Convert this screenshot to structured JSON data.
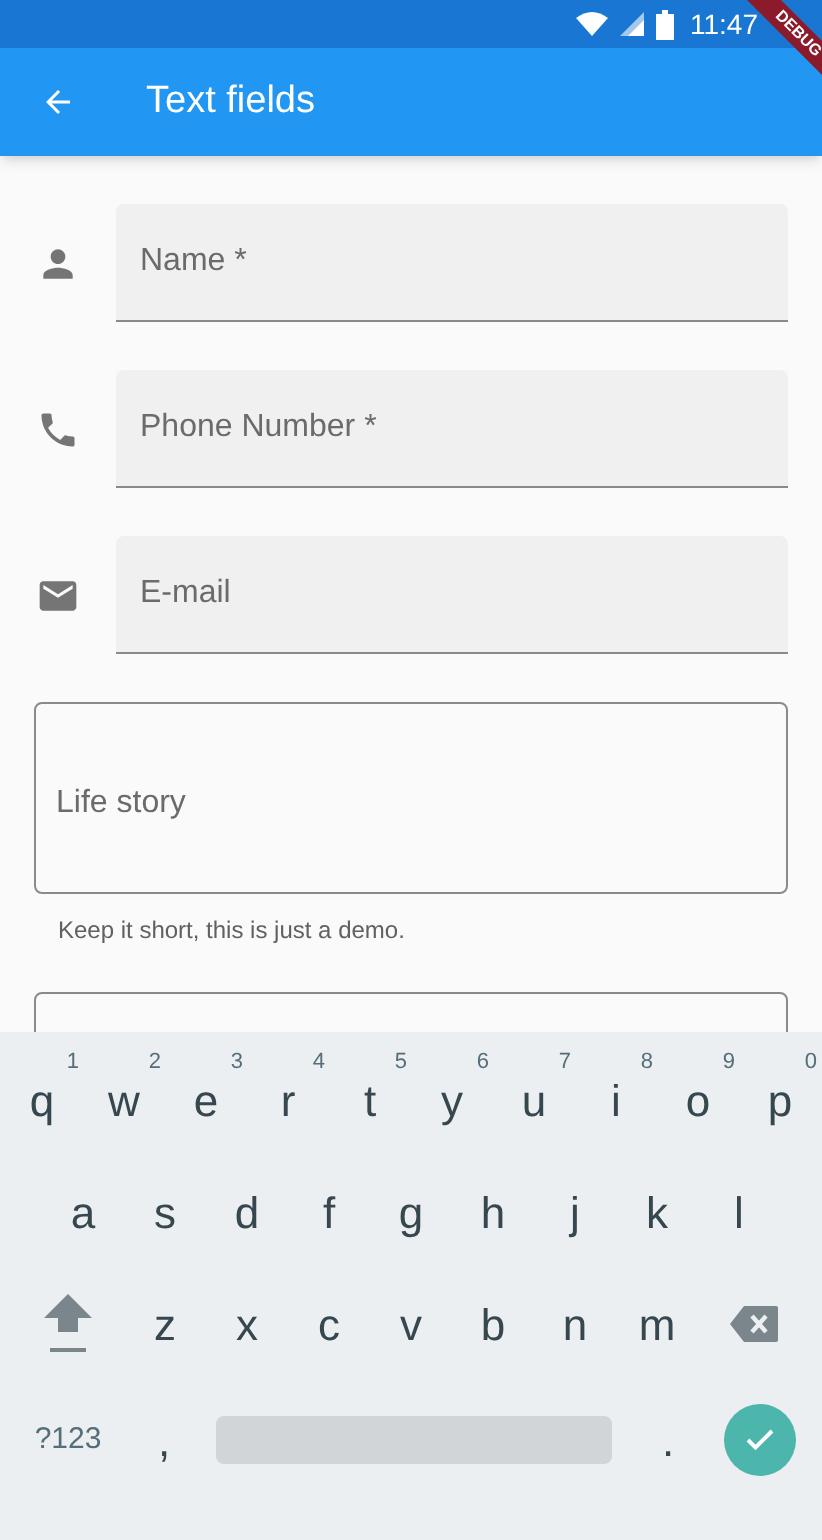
{
  "status_bar": {
    "time": "11:47"
  },
  "debug_banner": "DEBUG",
  "app_bar": {
    "title": "Text fields"
  },
  "fields": [
    {
      "kind": "filled",
      "placeholder": "Name *"
    },
    {
      "kind": "filled",
      "placeholder": "Phone Number *"
    },
    {
      "kind": "filled",
      "placeholder": "E-mail"
    },
    {
      "kind": "outlined",
      "placeholder": "Life story",
      "helper": "Keep it short, this is just a demo."
    },
    {
      "kind": "outlined_cut"
    }
  ],
  "keyboard": {
    "rows": [
      [
        {
          "key": "q",
          "hint": "1"
        },
        {
          "key": "w",
          "hint": "2"
        },
        {
          "key": "e",
          "hint": "3"
        },
        {
          "key": "r",
          "hint": "4"
        },
        {
          "key": "t",
          "hint": "5"
        },
        {
          "key": "y",
          "hint": "6"
        },
        {
          "key": "u",
          "hint": "7"
        },
        {
          "key": "i",
          "hint": "8"
        },
        {
          "key": "o",
          "hint": "9"
        },
        {
          "key": "p",
          "hint": "0"
        }
      ],
      [
        {
          "key": "a"
        },
        {
          "key": "s"
        },
        {
          "key": "d"
        },
        {
          "key": "f"
        },
        {
          "key": "g"
        },
        {
          "key": "h"
        },
        {
          "key": "j"
        },
        {
          "key": "k"
        },
        {
          "key": "l"
        }
      ],
      [
        {
          "key": "z"
        },
        {
          "key": "x"
        },
        {
          "key": "c"
        },
        {
          "key": "v"
        },
        {
          "key": "b"
        },
        {
          "key": "n"
        },
        {
          "key": "m"
        }
      ]
    ],
    "symbols_key": "?123",
    "comma": ",",
    "period": "."
  }
}
